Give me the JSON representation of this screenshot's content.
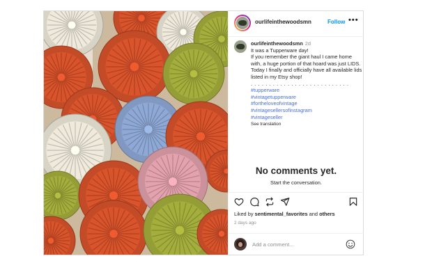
{
  "post": {
    "username": "ourlifeinthewoodsmn",
    "follow_label": "Follow",
    "more_label": "•••",
    "caption": {
      "username": "ourlifeinthewoodsmn",
      "time": "2d",
      "lines": [
        "It was a Tupperware day!",
        "If you remember the giant haul I came home with, a huge portion of that hoard was just LIDS.  Today I finally and officially have all available lids listed in my Etsy shop!"
      ],
      "dots": ". . . . . . . . . . . . . . . . . . . . . . . . . . .",
      "hashtags": [
        "#tupperware",
        "#vintagetupperware",
        "#fortheloveofvintage",
        "#vintagesellersofinstagram",
        "#vintageseller"
      ],
      "see_translation": "See translation"
    },
    "no_comments": {
      "title": "No comments yet.",
      "subtitle": "Start the conversation."
    },
    "likes": {
      "prefix": "Liked by",
      "user": "sentimental_favorites",
      "and": "and",
      "others": "others"
    },
    "time_ago": "2 days ago",
    "comment_placeholder": "Add a comment...",
    "icons": [
      "heart-icon",
      "comment-icon",
      "share-icon",
      "send-icon",
      "bookmark-icon",
      "emoji-icon",
      "more-icon"
    ],
    "colors": {
      "follow": "#0095f6",
      "hashtag": "#4a6fd9",
      "lid_orange": "#d9532b",
      "lid_green": "#a4ae3c",
      "lid_blue": "#8fa9d6",
      "lid_pink": "#e3a2ad",
      "lid_cream": "#efeadb"
    }
  }
}
